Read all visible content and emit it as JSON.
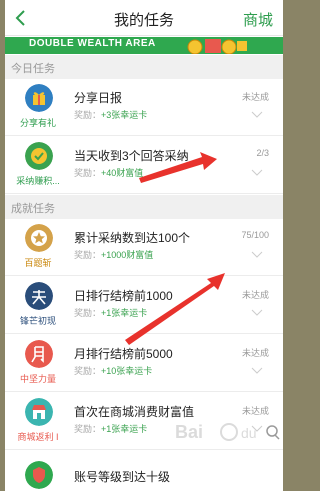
{
  "header": {
    "title": "我的任务",
    "mall_label": "商城",
    "back_icon": "chevron-left-icon"
  },
  "banner": {
    "text": "DOUBLE WEALTH AREA"
  },
  "sections": {
    "today": "今日任务",
    "achievement": "成就任务"
  },
  "tasks": [
    {
      "title": "分享日报",
      "reward_prefix": "奖励：",
      "reward_value": "+3张幸运卡",
      "status": "未达成",
      "icon_caption": "分享有礼",
      "icon_color": "#2f7fc1",
      "caption_color": "#2e9d4e"
    },
    {
      "title": "当天收到3个回答采纳",
      "reward_prefix": "奖励：",
      "reward_value": "+40财富值",
      "status": "2/3",
      "icon_caption": "采纳赚积...",
      "icon_color": "#3aa24f",
      "caption_color": "#2e9d4e"
    },
    {
      "title": "累计采纳数到达100个",
      "reward_prefix": "奖励：",
      "reward_value": "+1000财富值",
      "status": "75/100",
      "icon_caption": "百题斩",
      "icon_color": "#d4a24a",
      "caption_color": "#c9860a"
    },
    {
      "title": "日排行结榜前1000",
      "reward_prefix": "奖励：",
      "reward_value": "+1张幸运卡",
      "status": "未达成",
      "icon_caption": "锋芒初现",
      "icon_color": "#2a4d7a",
      "caption_color": "#2a4d7a"
    },
    {
      "title": "月排行结榜前5000",
      "reward_prefix": "奖励：",
      "reward_value": "+10张幸运卡",
      "status": "未达成",
      "icon_caption": "中坚力量",
      "icon_color": "#e8594e",
      "caption_color": "#e8594e"
    },
    {
      "title": "首次在商城消费财富值",
      "reward_prefix": "奖励：",
      "reward_value": "+1张幸运卡",
      "status": "未达成",
      "icon_caption": "商城返利 I",
      "icon_color": "#3bb5b0",
      "caption_color": "#e8594e"
    },
    {
      "title": "账号等级到达十级",
      "reward_prefix": "",
      "reward_value": "",
      "status": "",
      "icon_caption": "",
      "icon_color": "#2fa84f",
      "caption_color": "#2e9d4e"
    }
  ],
  "icons": [
    "gift-icon",
    "check-badge-icon",
    "star-medal-icon",
    "heaven-char-icon",
    "moon-char-icon",
    "shop-icon",
    "shield-icon"
  ],
  "colors": {
    "accent": "#2e9d4e",
    "arrow": "#e8322c",
    "banner": "#2fa84f"
  }
}
